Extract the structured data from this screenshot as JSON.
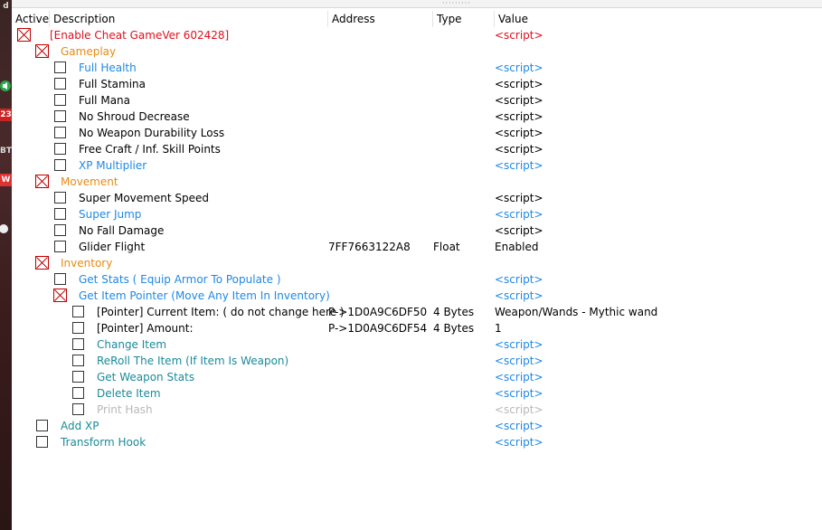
{
  "header": {
    "active": "Active",
    "description": "Description",
    "address": "Address",
    "type": "Type",
    "value": "Value"
  },
  "left_strip": {
    "labels": [
      "d",
      "23",
      "BT",
      "W"
    ]
  },
  "colors": {
    "red": "#e0101e",
    "orange": "#e88a12",
    "blue": "#1e88e5",
    "teal": "#1a8a9a",
    "gray": "#b8b8b8",
    "black": "#000000"
  },
  "rows": [
    {
      "level": 0,
      "grp": true,
      "desc": "[Enable Cheat GameVer 602428]",
      "addr": "",
      "type": "",
      "value": "<script>",
      "color": "red"
    },
    {
      "level": 1,
      "grp": true,
      "desc": "Gameplay",
      "addr": "",
      "type": "",
      "value": "",
      "color": "orange"
    },
    {
      "level": 2,
      "grp": false,
      "desc": "Full Health",
      "addr": "",
      "type": "",
      "value": "<script>",
      "color": "blue"
    },
    {
      "level": 2,
      "grp": false,
      "desc": "Full Stamina",
      "addr": "",
      "type": "",
      "value": "<script>",
      "color": "black"
    },
    {
      "level": 2,
      "grp": false,
      "desc": "Full Mana",
      "addr": "",
      "type": "",
      "value": "<script>",
      "color": "black"
    },
    {
      "level": 2,
      "grp": false,
      "desc": "No Shroud Decrease",
      "addr": "",
      "type": "",
      "value": "<script>",
      "color": "black"
    },
    {
      "level": 2,
      "grp": false,
      "desc": "No Weapon Durability Loss",
      "addr": "",
      "type": "",
      "value": "<script>",
      "color": "black"
    },
    {
      "level": 2,
      "grp": false,
      "desc": "Free Craft / Inf. Skill Points",
      "addr": "",
      "type": "",
      "value": "<script>",
      "color": "black"
    },
    {
      "level": 2,
      "grp": false,
      "desc": "XP Multiplier",
      "addr": "",
      "type": "",
      "value": "<script>",
      "color": "blue"
    },
    {
      "level": 1,
      "grp": true,
      "desc": "Movement",
      "addr": "",
      "type": "",
      "value": "",
      "color": "orange"
    },
    {
      "level": 2,
      "grp": false,
      "desc": "Super Movement Speed",
      "addr": "",
      "type": "",
      "value": "<script>",
      "color": "black"
    },
    {
      "level": 2,
      "grp": false,
      "desc": "Super Jump",
      "addr": "",
      "type": "",
      "value": "<script>",
      "color": "blue"
    },
    {
      "level": 2,
      "grp": false,
      "desc": "No Fall Damage",
      "addr": "",
      "type": "",
      "value": "<script>",
      "color": "black"
    },
    {
      "level": 2,
      "grp": false,
      "desc": "Glider Flight",
      "addr": "7FF7663122A8",
      "type": "Float",
      "value": "Enabled",
      "color": "black"
    },
    {
      "level": 1,
      "grp": true,
      "desc": "Inventory",
      "addr": "",
      "type": "",
      "value": "",
      "color": "orange"
    },
    {
      "level": 2,
      "grp": false,
      "desc": "Get Stats ( Equip Armor To Populate )",
      "addr": "",
      "type": "",
      "value": "<script>",
      "color": "blue"
    },
    {
      "level": 2,
      "grp": true,
      "desc": "Get Item Pointer (Move Any Item In Inventory)",
      "addr": "",
      "type": "",
      "value": "<script>",
      "color": "blue"
    },
    {
      "level": 3,
      "grp": false,
      "desc": "[Pointer] Current Item: ( do not change here )",
      "addr": "P->1D0A9C6DF50",
      "type": "4 Bytes",
      "value": "Weapon/Wands - Mythic wand",
      "color": "black"
    },
    {
      "level": 3,
      "grp": false,
      "desc": "[Pointer] Amount:",
      "addr": "P->1D0A9C6DF54",
      "type": "4 Bytes",
      "value": "1",
      "color": "black"
    },
    {
      "level": 3,
      "grp": false,
      "desc": "Change Item",
      "addr": "",
      "type": "",
      "value": "<script>",
      "color": "teal"
    },
    {
      "level": 3,
      "grp": false,
      "desc": "ReRoll The Item (If Item Is Weapon)",
      "addr": "",
      "type": "",
      "value": "<script>",
      "color": "teal"
    },
    {
      "level": 3,
      "grp": false,
      "desc": "Get Weapon Stats",
      "addr": "",
      "type": "",
      "value": "<script>",
      "color": "teal"
    },
    {
      "level": 3,
      "grp": false,
      "desc": "Delete Item",
      "addr": "",
      "type": "",
      "value": "<script>",
      "color": "teal"
    },
    {
      "level": 3,
      "grp": false,
      "desc": "Print Hash",
      "addr": "",
      "type": "",
      "value": "<script>",
      "color": "gray"
    },
    {
      "level": 1,
      "grp": false,
      "desc": "Add XP",
      "addr": "",
      "type": "",
      "value": "<script>",
      "color": "teal"
    },
    {
      "level": 1,
      "grp": false,
      "desc": "Transform Hook",
      "addr": "",
      "type": "",
      "value": "<script>",
      "color": "teal"
    }
  ]
}
